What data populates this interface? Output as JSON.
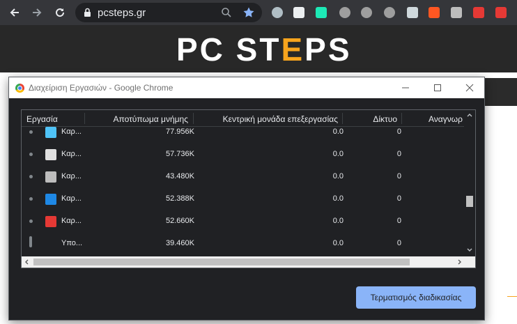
{
  "browser": {
    "url": "pcsteps.gr",
    "extensions": [
      "loading-ring-icon",
      "screen-icon",
      "shield-check-icon",
      "ublock-icon",
      "d-icon",
      "circle-icon",
      "shield-icon",
      "pen-icon",
      "image-icon",
      "office-icon",
      "gmail-icon"
    ]
  },
  "site": {
    "logo_part1": "PC ST",
    "logo_e": "E",
    "logo_part2": "PS"
  },
  "task_manager": {
    "title": "Διαχείριση Εργασιών - Google Chrome",
    "columns": {
      "task": "Εργασία",
      "memory": "Αποτύπωμα μνήμης",
      "cpu": "Κεντρική μονάδα επεξεργασίας",
      "network": "Δίκτυο",
      "process": "Αναγνωρ"
    },
    "rows": [
      {
        "name": "Καρ...",
        "memory": "77.956K",
        "cpu": "0.0",
        "network": "0",
        "icon": "puzzle-icon",
        "color": "#4fc3f7"
      },
      {
        "name": "Καρ...",
        "memory": "57.736K",
        "cpu": "0.0",
        "network": "0",
        "icon": "wordpress-icon",
        "color": "#e0e0e0"
      },
      {
        "name": "Καρ...",
        "memory": "43.480K",
        "cpu": "0.0",
        "network": "0",
        "icon": "keyboard-icon",
        "color": "#bdbdbd"
      },
      {
        "name": "Καρ...",
        "memory": "52.388K",
        "cpu": "0.0",
        "network": "0",
        "icon": "check-badge-icon",
        "color": "#1e88e5"
      },
      {
        "name": "Καρ...",
        "memory": "52.660K",
        "cpu": "0.0",
        "network": "0",
        "icon": "pdf-tool-icon",
        "color": "#e53935"
      },
      {
        "name": "Υπο...",
        "memory": "39.460K",
        "cpu": "0.0",
        "network": "0",
        "icon": "",
        "color": ""
      }
    ],
    "end_process_label": "Τερματισμός διαδικασίας"
  }
}
